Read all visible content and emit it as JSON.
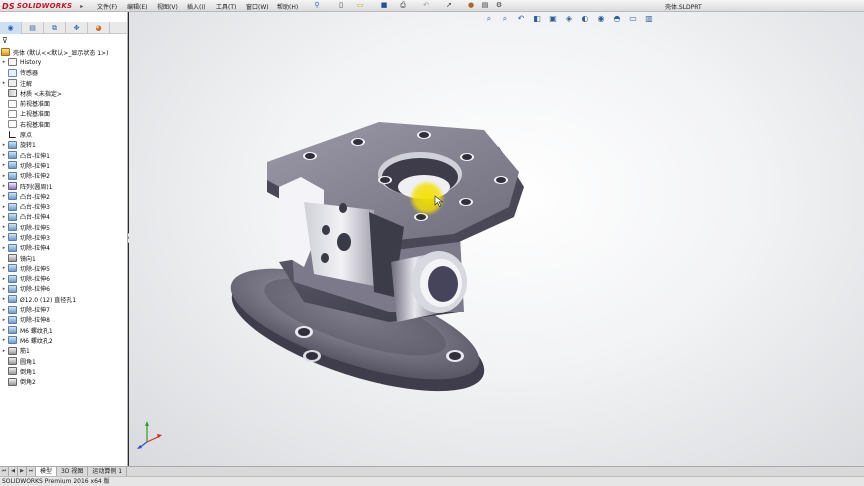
{
  "app": {
    "logo_text": "SOLIDWORKS",
    "logo_mark": "DS",
    "document_title": "壳体.SLDPRT"
  },
  "menu": [
    {
      "label": "文件(F)"
    },
    {
      "label": "编辑(E)"
    },
    {
      "label": "视图(V)"
    },
    {
      "label": "插入(I)"
    },
    {
      "label": "工具(T)"
    },
    {
      "label": "窗口(W)"
    },
    {
      "label": "帮助(H)"
    }
  ],
  "feature_tree": {
    "root": "壳体 (默认<<默认>_显示状态 1>)",
    "items": [
      {
        "label": "History",
        "icon": "history-icon",
        "expandable": true
      },
      {
        "label": "传感器",
        "icon": "sensor-icon",
        "expandable": false
      },
      {
        "label": "注解",
        "icon": "annotation-icon",
        "expandable": true
      },
      {
        "label": "材质 <未指定>",
        "icon": "material-icon",
        "expandable": false
      },
      {
        "label": "前视基准面",
        "icon": "plane-icon",
        "expandable": false
      },
      {
        "label": "上视基准面",
        "icon": "plane-icon",
        "expandable": false
      },
      {
        "label": "右视基准面",
        "icon": "plane-icon",
        "expandable": false
      },
      {
        "label": "原点",
        "icon": "origin-icon",
        "expandable": false
      },
      {
        "label": "旋转1",
        "icon": "revolve-icon",
        "expandable": true
      },
      {
        "label": "凸台-拉伸1",
        "icon": "boss-extrude-icon",
        "expandable": true
      },
      {
        "label": "切除-拉伸1",
        "icon": "cut-extrude-icon",
        "expandable": true
      },
      {
        "label": "切除-拉伸2",
        "icon": "cut-extrude-icon",
        "expandable": true
      },
      {
        "label": "阵列(圆周)1",
        "icon": "circular-pattern-icon",
        "expandable": true
      },
      {
        "label": "凸台-拉伸2",
        "icon": "boss-extrude-icon",
        "expandable": true
      },
      {
        "label": "凸台-拉伸3",
        "icon": "boss-extrude-icon",
        "expandable": true
      },
      {
        "label": "凸台-拉伸4",
        "icon": "boss-extrude-icon",
        "expandable": true
      },
      {
        "label": "切除-拉伸5",
        "icon": "cut-extrude-icon",
        "expandable": true
      },
      {
        "label": "切除-拉伸3",
        "icon": "cut-extrude-icon",
        "expandable": true
      },
      {
        "label": "切除-拉伸4",
        "icon": "cut-extrude-icon",
        "expandable": true
      },
      {
        "label": "镜向1",
        "icon": "mirror-icon",
        "expandable": false
      },
      {
        "label": "切除-拉伸5",
        "icon": "cut-extrude-icon",
        "expandable": true
      },
      {
        "label": "切除-拉伸6",
        "icon": "cut-extrude-icon",
        "expandable": true
      },
      {
        "label": "切除-拉伸6",
        "icon": "cut-extrude-icon",
        "expandable": true
      },
      {
        "label": "Ø12.0 (12) 直径孔1",
        "icon": "hole-icon",
        "expandable": true
      },
      {
        "label": "切除-拉伸7",
        "icon": "cut-extrude-icon",
        "expandable": true
      },
      {
        "label": "切除-拉伸8",
        "icon": "cut-extrude-icon",
        "expandable": true
      },
      {
        "label": "M6 螺纹孔1",
        "icon": "hole-icon",
        "expandable": true
      },
      {
        "label": "M6 螺纹孔2",
        "icon": "hole-icon",
        "expandable": true
      },
      {
        "label": "筋1",
        "icon": "rib-icon",
        "expandable": true
      },
      {
        "label": "圆角1",
        "icon": "fillet-icon",
        "expandable": false
      },
      {
        "label": "倒角1",
        "icon": "chamfer-icon",
        "expandable": false
      },
      {
        "label": "倒角2",
        "icon": "chamfer-icon",
        "expandable": false
      }
    ]
  },
  "bottom_tabs": [
    {
      "label": "模型",
      "active": true
    },
    {
      "label": "3D 视图",
      "active": false
    },
    {
      "label": "运动算例 1",
      "active": false
    }
  ],
  "status_bar": {
    "text": "SOLIDWORKS Premium 2016 x64 版"
  },
  "colors": {
    "brand_red": "#c8102e",
    "model_gray": "#8e8c9a",
    "cursor_highlight": "#f4e000"
  }
}
